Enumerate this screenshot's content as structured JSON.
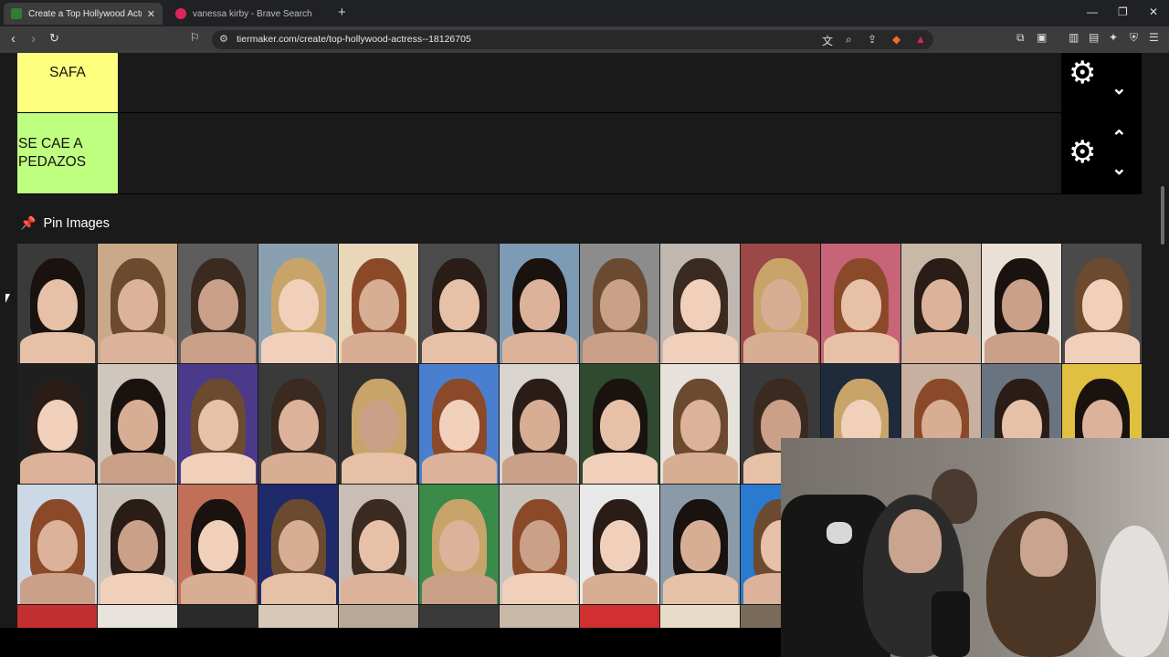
{
  "browser": {
    "tabs": [
      {
        "title": "Create a Top Hollywood Actress",
        "active": true
      },
      {
        "title": "vanessa kirby - Brave Search",
        "active": false
      }
    ],
    "url": "tiermaker.com/create/top-hollywood-actress--18126705"
  },
  "tiers": [
    {
      "label": "SAFA",
      "color": "#ffff7f"
    },
    {
      "label": "SE CAE A PEDAZOS",
      "color": "#bfff7f"
    }
  ],
  "pin_section": {
    "title": "Pin Images"
  },
  "image_grid": {
    "rows": [
      [
        "#3a3a3a",
        "#c9a98a",
        "#5d5d5d",
        "#8aa0b0",
        "#e8d7b8",
        "#4b4b4b",
        "#7d9bb5",
        "#8c8c8c",
        "#c0b8b0",
        "#9c4848",
        "#c86478",
        "#c9b8a8",
        "#ebe0d6",
        "#4a4a4a"
      ],
      [
        "#1f1f1f",
        "#cfc7be",
        "#4b3a8a",
        "#3a3a3a",
        "#2f2f2f",
        "#4a7fd0",
        "#d9d4cd",
        "#2f4a2f",
        "#e6e1db",
        "#3a3a3a",
        "#1f2a3a",
        "#c8b0a0",
        "#6a7480",
        "#e0c040"
      ],
      [
        "#cdd8e6",
        "#c9c2bb",
        "#c07058",
        "#1f2a6a",
        "#c9bdb5",
        "#3a8a4a",
        "#c8c2bc",
        "#e8e8e8",
        "#8a9aa8",
        "#2a7ad0"
      ]
    ]
  },
  "webcam": {
    "label": "streamer camera overlay"
  }
}
